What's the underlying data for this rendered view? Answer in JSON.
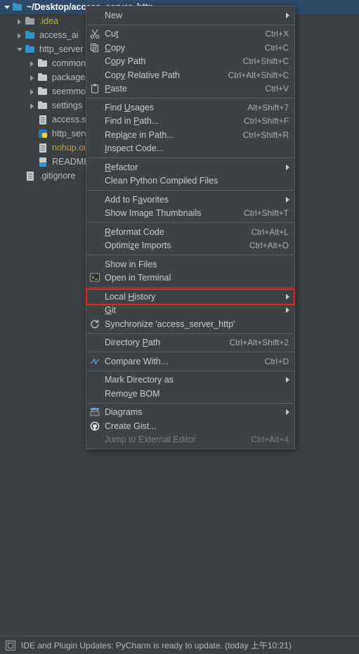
{
  "tree": {
    "items": [
      {
        "indent": 0,
        "twisty": "expanded",
        "icon": "folder-blue",
        "label": "~/Desktop/access_server_http",
        "color": "normal",
        "selected": true
      },
      {
        "indent": 1,
        "twisty": "collapsed",
        "icon": "folder-grey",
        "label": ".idea",
        "color": "yellow",
        "selected": false
      },
      {
        "indent": 1,
        "twisty": "collapsed",
        "icon": "folder-blue",
        "label": "access_ai",
        "color": "normal",
        "selected": false
      },
      {
        "indent": 1,
        "twisty": "expanded",
        "icon": "folder-blue",
        "label": "http_server",
        "color": "normal",
        "selected": false
      },
      {
        "indent": 2,
        "twisty": "collapsed",
        "icon": "folder-white",
        "label": "common",
        "color": "normal",
        "selected": false
      },
      {
        "indent": 2,
        "twisty": "collapsed",
        "icon": "folder-white",
        "label": "packages",
        "color": "normal",
        "selected": false
      },
      {
        "indent": 2,
        "twisty": "collapsed",
        "icon": "folder-white",
        "label": "seemmo",
        "color": "normal",
        "selected": false
      },
      {
        "indent": 2,
        "twisty": "collapsed",
        "icon": "folder-white",
        "label": "settings",
        "color": "normal",
        "selected": false
      },
      {
        "indent": 2,
        "twisty": "none",
        "icon": "file",
        "label": "access.sh",
        "color": "normal",
        "selected": false
      },
      {
        "indent": 2,
        "twisty": "none",
        "icon": "python-file",
        "label": "http_server.py",
        "color": "normal",
        "selected": false
      },
      {
        "indent": 2,
        "twisty": "none",
        "icon": "file",
        "label": "nohup.out",
        "color": "orange",
        "selected": false
      },
      {
        "indent": 2,
        "twisty": "none",
        "icon": "markdown-file",
        "label": "README.md",
        "color": "normal",
        "selected": false
      },
      {
        "indent": 1,
        "twisty": "none",
        "icon": "file",
        "label": ".gitignore",
        "color": "normal",
        "selected": false
      }
    ]
  },
  "context_menu": {
    "groups": [
      [
        {
          "icon": "none",
          "label": "New",
          "pre": "",
          "mnemonic": "",
          "post": "New",
          "key": "",
          "submenu": true,
          "disabled": false
        }
      ],
      [
        {
          "icon": "cut-icon",
          "label": "Cut",
          "pre": "Cu",
          "mnemonic": "t",
          "post": "",
          "key": "Ctrl+X",
          "submenu": false,
          "disabled": false
        },
        {
          "icon": "copy-icon",
          "label": "Copy",
          "pre": "",
          "mnemonic": "C",
          "post": "opy",
          "key": "Ctrl+C",
          "submenu": false,
          "disabled": false
        },
        {
          "icon": "none",
          "label": "Copy Path",
          "pre": "C",
          "mnemonic": "o",
          "post": "py Path",
          "key": "Ctrl+Shift+C",
          "submenu": false,
          "disabled": false
        },
        {
          "icon": "none",
          "label": "Copy Relative Path",
          "pre": "Cop",
          "mnemonic": "y",
          "post": " Relative Path",
          "key": "Ctrl+Alt+Shift+C",
          "submenu": false,
          "disabled": false
        },
        {
          "icon": "paste-icon",
          "label": "Paste",
          "pre": "",
          "mnemonic": "P",
          "post": "aste",
          "key": "Ctrl+V",
          "submenu": false,
          "disabled": false
        }
      ],
      [
        {
          "icon": "none",
          "label": "Find Usages",
          "pre": "Find ",
          "mnemonic": "U",
          "post": "sages",
          "key": "Alt+Shift+7",
          "submenu": false,
          "disabled": false
        },
        {
          "icon": "none",
          "label": "Find in Path...",
          "pre": "Find in ",
          "mnemonic": "P",
          "post": "ath...",
          "key": "Ctrl+Shift+F",
          "submenu": false,
          "disabled": false
        },
        {
          "icon": "none",
          "label": "Replace in Path...",
          "pre": "Repl",
          "mnemonic": "a",
          "post": "ce in Path...",
          "key": "Ctrl+Shift+R",
          "submenu": false,
          "disabled": false
        },
        {
          "icon": "none",
          "label": "Inspect Code...",
          "pre": "",
          "mnemonic": "I",
          "post": "nspect Code...",
          "key": "",
          "submenu": false,
          "disabled": false
        }
      ],
      [
        {
          "icon": "none",
          "label": "Refactor",
          "pre": "",
          "mnemonic": "R",
          "post": "efactor",
          "key": "",
          "submenu": true,
          "disabled": false
        },
        {
          "icon": "none",
          "label": "Clean Python Compiled Files",
          "pre": "Clean Python Compiled Files",
          "mnemonic": "",
          "post": "",
          "key": "",
          "submenu": false,
          "disabled": false
        }
      ],
      [
        {
          "icon": "none",
          "label": "Add to Favorites",
          "pre": "Add to F",
          "mnemonic": "a",
          "post": "vorites",
          "key": "",
          "submenu": true,
          "disabled": false
        },
        {
          "icon": "none",
          "label": "Show Image Thumbnails",
          "pre": "Show Image Thumbnails",
          "mnemonic": "",
          "post": "",
          "key": "Ctrl+Shift+T",
          "submenu": false,
          "disabled": false
        }
      ],
      [
        {
          "icon": "none",
          "label": "Reformat Code",
          "pre": "",
          "mnemonic": "R",
          "post": "eformat Code",
          "key": "Ctrl+Alt+L",
          "submenu": false,
          "disabled": false
        },
        {
          "icon": "none",
          "label": "Optimize Imports",
          "pre": "Optimi",
          "mnemonic": "z",
          "post": "e Imports",
          "key": "Ctrl+Alt+O",
          "submenu": false,
          "disabled": false
        }
      ],
      [
        {
          "icon": "none",
          "label": "Show in Files",
          "pre": "Show in Files",
          "mnemonic": "",
          "post": "",
          "key": "",
          "submenu": false,
          "disabled": false
        },
        {
          "icon": "terminal-icon",
          "label": "Open in Terminal",
          "pre": "Open in Terminal",
          "mnemonic": "",
          "post": "",
          "key": "",
          "submenu": false,
          "disabled": false
        }
      ],
      [
        {
          "icon": "none",
          "label": "Local History",
          "pre": "Local ",
          "mnemonic": "H",
          "post": "istory",
          "key": "",
          "submenu": true,
          "disabled": false,
          "highlighted": true
        },
        {
          "icon": "none",
          "label": "Git",
          "pre": "",
          "mnemonic": "G",
          "post": "it",
          "key": "",
          "submenu": true,
          "disabled": false
        },
        {
          "icon": "sync-icon",
          "label": "Synchronize 'access_server_http'",
          "pre": "Synchronize 'access_server_http'",
          "mnemonic": "",
          "post": "",
          "key": "",
          "submenu": false,
          "disabled": false
        }
      ],
      [
        {
          "icon": "none",
          "label": "Directory Path",
          "pre": "Directory ",
          "mnemonic": "P",
          "post": "ath",
          "key": "Ctrl+Alt+Shift+2",
          "submenu": false,
          "disabled": false
        }
      ],
      [
        {
          "icon": "compare-icon",
          "label": "Compare With...",
          "pre": "Compare With...",
          "mnemonic": "",
          "post": "",
          "key": "Ctrl+D",
          "submenu": false,
          "disabled": false
        }
      ],
      [
        {
          "icon": "none",
          "label": "Mark Directory as",
          "pre": "Mark Directory as",
          "mnemonic": "",
          "post": "",
          "key": "",
          "submenu": true,
          "disabled": false
        },
        {
          "icon": "none",
          "label": "Remove BOM",
          "pre": "Remo",
          "mnemonic": "v",
          "post": "e BOM",
          "key": "",
          "submenu": false,
          "disabled": false
        }
      ],
      [
        {
          "icon": "diagrams-icon",
          "label": "Diagrams",
          "pre": "Diagrams",
          "mnemonic": "",
          "post": "",
          "key": "",
          "submenu": true,
          "disabled": false
        },
        {
          "icon": "github-icon",
          "label": "Create Gist...",
          "pre": "Create Gist...",
          "mnemonic": "",
          "post": "",
          "key": "",
          "submenu": false,
          "disabled": false
        },
        {
          "icon": "none",
          "label": "Jump to External Editor",
          "pre": "Jump to External Editor",
          "mnemonic": "",
          "post": "",
          "key": "Ctrl+Alt+4",
          "submenu": false,
          "disabled": true
        }
      ]
    ]
  },
  "status_bar": {
    "icon": "notification-icon",
    "message": "IDE and Plugin Updates: PyCharm is ready to update. (today 上午10:21)"
  },
  "colors": {
    "selection_blue": "#2E4A68",
    "menu_bg": "#3F4244",
    "panel_bg": "#3C3F41",
    "highlight_red": "#E8202A",
    "folder_blue": "#3592C4",
    "text_yellow": "#BBB529"
  }
}
